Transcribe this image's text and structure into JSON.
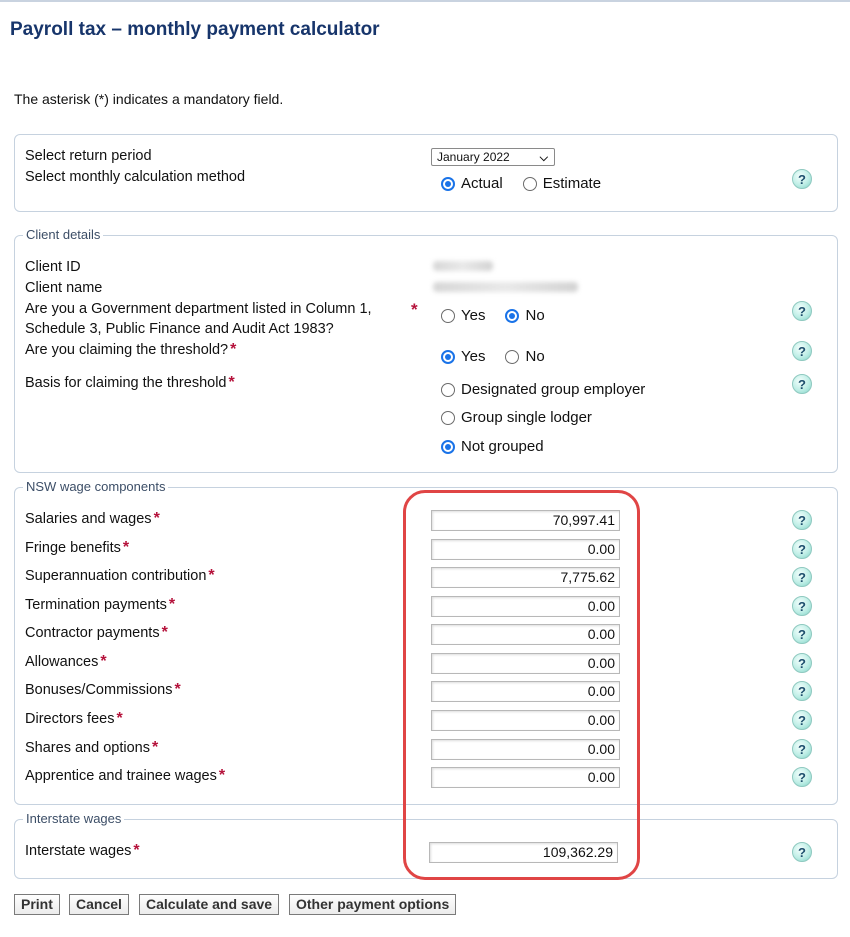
{
  "page": {
    "title": "Payroll tax – monthly payment calculator",
    "mandatory_note": "The asterisk (*) indicates a mandatory field."
  },
  "period_section": {
    "return_period_label": "Select return period",
    "return_period_value": "January 2022",
    "method_label": "Select monthly calculation method",
    "method_options": [
      "Actual",
      "Estimate"
    ],
    "method_selected": "Actual",
    "help_icon": "help-icon"
  },
  "client_details": {
    "legend": "Client details",
    "client_id_label": "Client ID",
    "client_name_label": "Client name",
    "gov_dept_label_line1": "Are you a Government department listed in Column 1,",
    "gov_dept_label_line2": "Schedule 3, Public Finance and Audit Act 1983?",
    "gov_dept_options": [
      "Yes",
      "No"
    ],
    "gov_dept_selected": "No",
    "threshold_label": "Are you claiming the threshold?",
    "threshold_options": [
      "Yes",
      "No"
    ],
    "threshold_selected": "Yes",
    "basis_label": "Basis for claiming the threshold",
    "basis_options": [
      "Designated group employer",
      "Group single lodger",
      "Not grouped"
    ],
    "basis_selected": "Not grouped"
  },
  "nsw_wages": {
    "legend": "NSW wage components",
    "rows": [
      {
        "label": "Salaries and wages",
        "value": "70,997.41"
      },
      {
        "label": "Fringe benefits",
        "value": "0.00"
      },
      {
        "label": "Superannuation contribution",
        "value": "7,775.62"
      },
      {
        "label": "Termination payments",
        "value": "0.00"
      },
      {
        "label": "Contractor payments",
        "value": "0.00"
      },
      {
        "label": "Allowances",
        "value": "0.00"
      },
      {
        "label": "Bonuses/Commissions",
        "value": "0.00"
      },
      {
        "label": "Directors fees",
        "value": "0.00"
      },
      {
        "label": "Shares and options",
        "value": "0.00"
      },
      {
        "label": "Apprentice and trainee wages",
        "value": "0.00"
      }
    ]
  },
  "interstate": {
    "legend": "Interstate wages",
    "label": "Interstate wages",
    "value": "109,362.29"
  },
  "buttons": {
    "print": "Print",
    "cancel": "Cancel",
    "calculate": "Calculate and save",
    "other": "Other payment options"
  },
  "symbols": {
    "star": "*",
    "help": "?",
    "chevron": "⌄"
  },
  "colors": {
    "title": "#17356b",
    "mandatory_star": "#b5123b",
    "radio_selected": "#1a73e8",
    "highlight_ring": "#e04545"
  }
}
